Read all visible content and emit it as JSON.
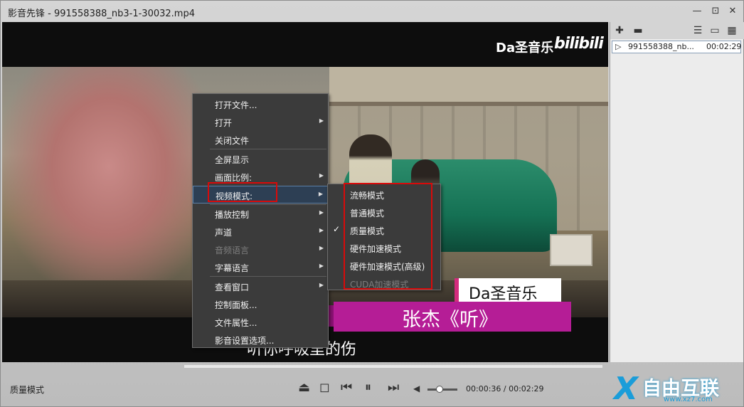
{
  "window": {
    "title": "影音先锋 - 991558388_nb3-1-30032.mp4",
    "controls": [
      "—",
      "⊡",
      "✕"
    ]
  },
  "video": {
    "logo_text": "Da圣音乐",
    "logo_brand": "bilibili",
    "caption_name": "Da圣音乐",
    "song_title": "张杰《听》",
    "lyric": "听你呼吸里的伤"
  },
  "playlist": {
    "items": [
      {
        "name": "991558388_nb...",
        "duration": "00:02:29"
      }
    ]
  },
  "context_menu": {
    "items": [
      {
        "label": "打开文件...",
        "submenu": false,
        "disabled": false
      },
      {
        "label": "打开",
        "submenu": true,
        "disabled": false
      },
      {
        "label": "关闭文件",
        "submenu": false,
        "disabled": false
      },
      {
        "label": "全屏显示",
        "submenu": false,
        "disabled": false
      },
      {
        "label": "画面比例:",
        "submenu": true,
        "disabled": false
      },
      {
        "label": "视频模式:",
        "submenu": true,
        "disabled": false,
        "active": true
      },
      {
        "label": "播放控制",
        "submenu": true,
        "disabled": false
      },
      {
        "label": "声道",
        "submenu": true,
        "disabled": false
      },
      {
        "label": "音频语言",
        "submenu": true,
        "disabled": true
      },
      {
        "label": "字幕语言",
        "submenu": true,
        "disabled": false
      },
      {
        "label": "查看窗口",
        "submenu": true,
        "disabled": false
      },
      {
        "label": "控制面板...",
        "submenu": false,
        "disabled": false
      },
      {
        "label": "文件属性...",
        "submenu": false,
        "disabled": false
      },
      {
        "label": "影音设置选项...",
        "submenu": false,
        "disabled": false
      }
    ]
  },
  "video_mode_submenu": {
    "items": [
      {
        "label": "流畅模式",
        "checked": false,
        "disabled": false
      },
      {
        "label": "普通模式",
        "checked": false,
        "disabled": false
      },
      {
        "label": "质量模式",
        "checked": true,
        "disabled": false
      },
      {
        "label": "硬件加速模式",
        "checked": false,
        "disabled": false
      },
      {
        "label": "硬件加速模式(高级)",
        "checked": false,
        "disabled": false
      },
      {
        "label": "CUDA加速模式",
        "checked": false,
        "disabled": true
      }
    ]
  },
  "status_bar": {
    "mode_label": "质量模式",
    "time": "00:00:36 / 00:02:29",
    "volume_fraction": 0.4
  },
  "watermark": {
    "text": "自由互联",
    "url": "www.xz7.com"
  },
  "colors": {
    "highlight_box": "#d90a0a",
    "menu_bg": "#3b3b3b",
    "caption_magenta": "#b51d96"
  }
}
